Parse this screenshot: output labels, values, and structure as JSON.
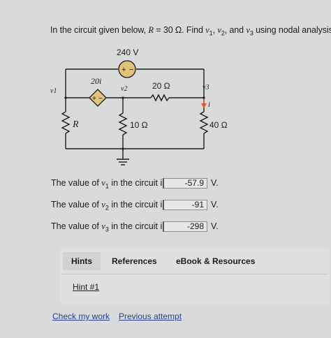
{
  "question": {
    "prefix": "In the circuit given below, ",
    "r_var": "R",
    "r_value": " = 30 Ω. Find ",
    "v1": "v",
    "v1_sub": "1",
    "sep1": ", ",
    "v2": "v",
    "v2_sub": "2",
    "sep2": ", and ",
    "v3": "v",
    "v3_sub": "3",
    "suffix": " using nodal analysis."
  },
  "circuit": {
    "source_label": "240 V",
    "dep_source_label": "20i",
    "v1_label": "v1",
    "v2_label": "v2",
    "v3_label": "v3",
    "r20_label": "20 Ω",
    "r10_label": "10 Ω",
    "r40_label": "40 Ω",
    "r_label": "R",
    "current_label": "i",
    "plus": "+",
    "minus": "−"
  },
  "answers": [
    {
      "text_prefix": "The value of ",
      "var": "v",
      "sub": "1",
      "text_suffix": " in the circuit is",
      "value": "-57.9",
      "unit": "V."
    },
    {
      "text_prefix": "The value of ",
      "var": "v",
      "sub": "2",
      "text_suffix": " in the circuit is",
      "value": "-91",
      "unit": "V."
    },
    {
      "text_prefix": "The value of ",
      "var": "v",
      "sub": "3",
      "text_suffix": " in the circuit is",
      "value": "-298",
      "unit": "V."
    }
  ],
  "tabs": {
    "hints": "Hints",
    "references": "References",
    "ebook": "eBook & Resources"
  },
  "hint_link": "Hint #1",
  "footer": {
    "check": "Check my work",
    "previous": "Previous attempt"
  }
}
